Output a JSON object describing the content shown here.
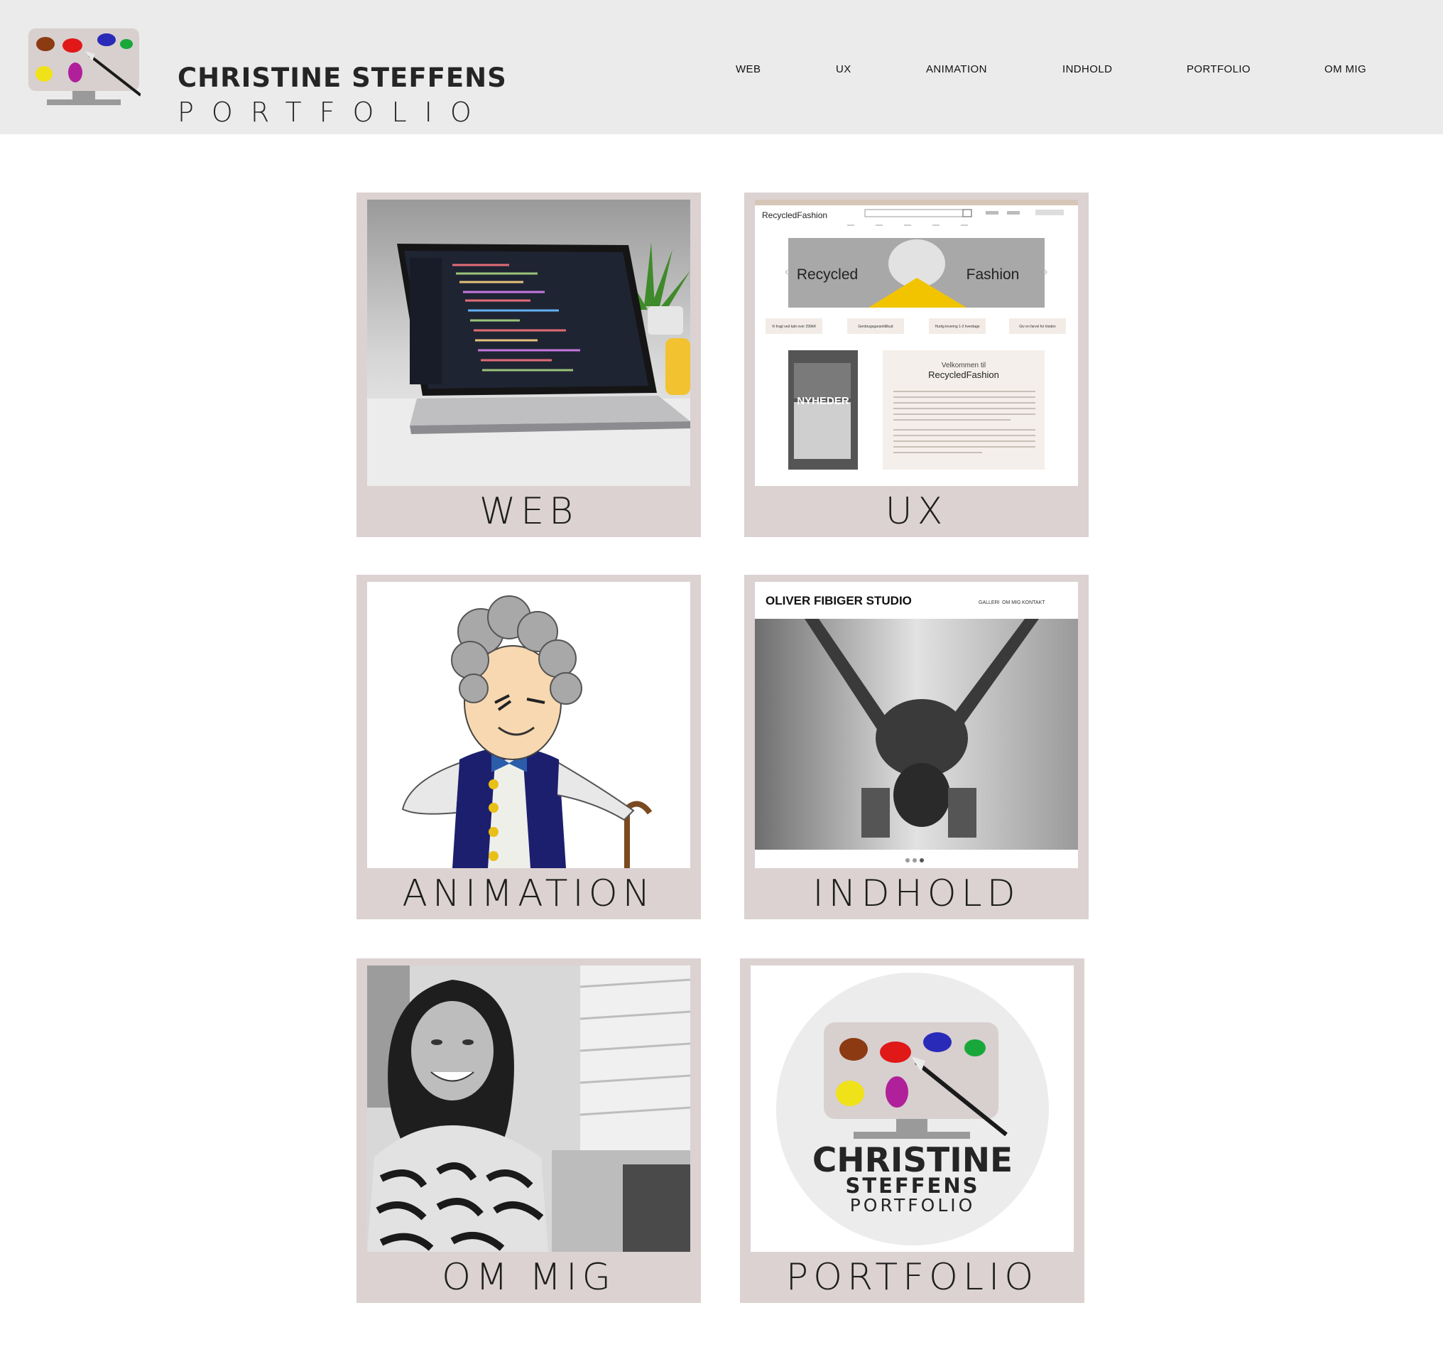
{
  "header": {
    "logo_title": "CHRISTINE STEFFENS",
    "logo_subtitle": "PORTFOLIO",
    "nav": [
      "WEB",
      "UX",
      "ANIMATION",
      "INDHOLD",
      "PORTFOLIO",
      "OM MIG"
    ]
  },
  "cards": [
    {
      "label": "WEB"
    },
    {
      "label": "UX"
    },
    {
      "label": "ANIMATION"
    },
    {
      "label": "INDHOLD"
    },
    {
      "label": "OM MIG"
    },
    {
      "label": "PORTFOLIO"
    }
  ],
  "ux_mock": {
    "brand_a": "Recycled",
    "brand_b": "Fashion",
    "hero_left": "Recycled",
    "hero_right": "Fashion",
    "pills": [
      "Vi fragt ved køb over 299kR",
      "Genbrugsgarantitilbud",
      "Hurtig levering 1-3 hverdage",
      "Giv en farvel for kloden"
    ],
    "tile_label": "NYHEDER",
    "welcome": "Velkommen til",
    "welcome_brand_a": "Recycled",
    "welcome_brand_b": "Fashion"
  },
  "indhold_mock": {
    "studio_title": "OLIVER FIBIGER STUDIO",
    "links": [
      "GALLERI",
      "OM MIG",
      "KONTAKT"
    ]
  },
  "portfolio_logo": {
    "line1": "CHRISTINE",
    "line2": "STEFFENS",
    "line3": "PORTFOLIO"
  },
  "colors": {
    "header_bg": "#ebebeb",
    "card_frame": "#dcd2d2",
    "text": "#1e1e1e"
  }
}
